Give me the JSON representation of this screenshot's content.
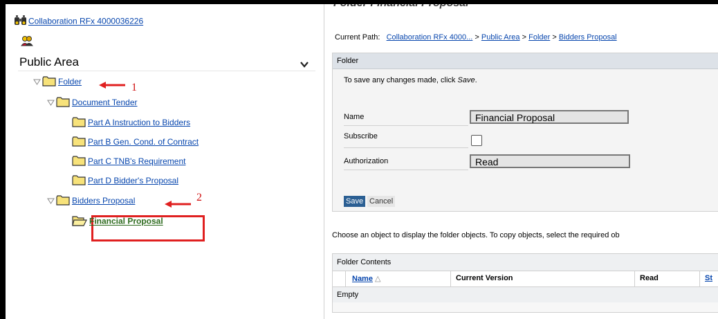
{
  "left": {
    "collab_link": "Collaboration RFx 4000036226",
    "area_select": {
      "value": "Public Area"
    },
    "tree": [
      {
        "label": "Folder",
        "annotation": "1"
      },
      {
        "label": "Document Tender"
      },
      {
        "label": "Part A Instruction to Bidders"
      },
      {
        "label": "Part B Gen. Cond. of Contract"
      },
      {
        "label": "Part C TNB's Requirement"
      },
      {
        "label": "Part D Bidder's Proposal"
      },
      {
        "label": "Bidders Proposal",
        "annotation": "2"
      },
      {
        "label": "Financial Proposal",
        "selected": true
      }
    ]
  },
  "right": {
    "title": "Folder Financial Proposal",
    "path": {
      "label": "Current Path:",
      "crumbs": [
        "Collaboration RFx 4000...",
        "Public Area",
        "Folder",
        "Bidders Proposal"
      ],
      "sep": ">"
    },
    "panel": {
      "header": "Folder",
      "hint_prefix": "To save any changes made, click ",
      "hint_em": "Save",
      "hint_suffix": ".",
      "name_label": "Name",
      "name_value": "Financial Proposal",
      "subscribe_label": "Subscribe",
      "auth_label": "Authorization",
      "auth_value": "Read",
      "save_btn": "Save",
      "cancel_btn": "Cancel"
    },
    "choose_text": "Choose an object to display the folder objects. To copy objects, select the required ob",
    "contents": {
      "header": "Folder Contents",
      "columns": [
        "Name",
        "Current Version",
        "Read",
        "St"
      ],
      "empty": "Empty"
    }
  },
  "colors": {
    "link": "#0645ad",
    "annotation": "#e02020",
    "save_button": "#2b5f93",
    "selected_link": "#2e6b1f"
  }
}
